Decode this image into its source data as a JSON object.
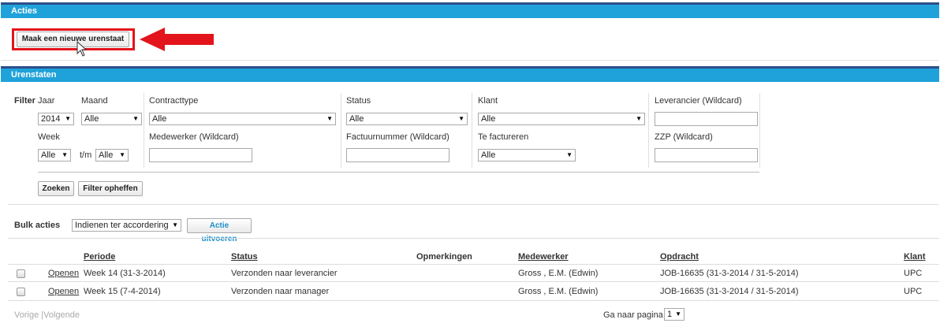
{
  "acties": {
    "header": "Acties",
    "new_button": "Maak een nieuwe urenstaat"
  },
  "urenstaten": {
    "header": "Urenstaten",
    "filter": {
      "label": "Filter",
      "jaar_label": "Jaar",
      "jaar_value": "2014",
      "maand_label": "Maand",
      "maand_value": "Alle",
      "contracttype_label": "Contracttype",
      "contracttype_value": "Alle",
      "status_label": "Status",
      "status_value": "Alle",
      "klant_label": "Klant",
      "klant_value": "Alle",
      "leverancier_label": "Leverancier (Wildcard)",
      "leverancier_value": "",
      "week_label": "Week",
      "week_from_value": "Alle",
      "tm_label": "t/m",
      "week_to_value": "Alle",
      "medewerker_label": "Medewerker (Wildcard)",
      "medewerker_value": "",
      "factuurnummer_label": "Factuurnummer (Wildcard)",
      "factuurnummer_value": "",
      "te_factureren_label": "Te factureren",
      "te_factureren_value": "Alle",
      "zzp_label": "ZZP (Wildcard)",
      "zzp_value": "",
      "search_button": "Zoeken",
      "clear_button": "Filter opheffen"
    },
    "bulk": {
      "label": "Bulk acties",
      "select_value": "Indienen ter accordering",
      "execute_button": "Actie uitvoeren"
    },
    "table": {
      "columns": {
        "periode": "Periode",
        "status": "Status",
        "opmerkingen": "Opmerkingen",
        "medewerker": "Medewerker",
        "opdracht": "Opdracht",
        "klant": "Klant"
      },
      "rows": [
        {
          "open": "Openen",
          "periode": "Week 14 (31-3-2014)",
          "status": "Verzonden naar leverancier",
          "opmerkingen": "",
          "medewerker": "Gross , E.M. (Edwin)",
          "opdracht": "JOB-16635 (31-3-2014 / 31-5-2014)",
          "klant": "UPC"
        },
        {
          "open": "Openen",
          "periode": "Week 15 (7-4-2014)",
          "status": "Verzonden naar manager",
          "opmerkingen": "",
          "medewerker": "Gross , E.M. (Edwin)",
          "opdracht": "JOB-16635 (31-3-2014 / 31-5-2014)",
          "klant": "UPC"
        }
      ]
    },
    "pager": {
      "prev": "Vorige",
      "separator": "|",
      "next": "Volgende",
      "goto_label": "Ga naar pagina",
      "page_value": "1"
    }
  },
  "colors": {
    "header_blue": "#1fa2d9",
    "top_line": "#2c4f8a",
    "highlight_red": "#e3141b",
    "link_blue": "#1e90c8"
  }
}
